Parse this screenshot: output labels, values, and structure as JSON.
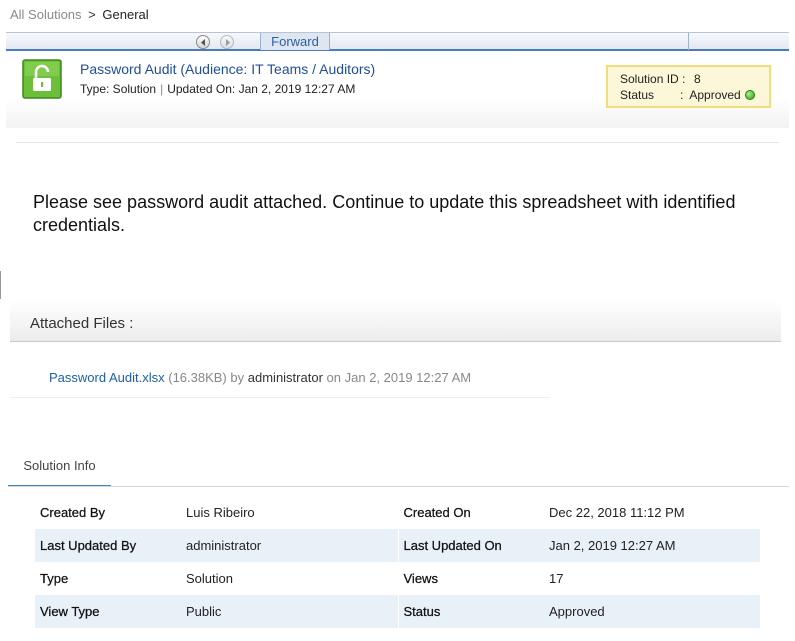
{
  "breadcrumb": {
    "root": "All Solutions",
    "separator": ">",
    "current": "General"
  },
  "toolbar": {
    "forward_label": "Forward"
  },
  "solution": {
    "title": "Password Audit (Audience: IT Teams / Auditors)",
    "type_text": "Type: Solution",
    "updated_text": "Updated On: Jan 2, 2019 12:27 AM"
  },
  "status_box": {
    "id_label": "Solution ID :",
    "id_value": "8",
    "status_label": "Status",
    "status_colon": ":",
    "status_value": "Approved",
    "status_color": "#2ea11a"
  },
  "description": "Please see password audit attached.  Continue to update this spreadsheet with identified credentials.",
  "attachments": {
    "header": "Attached Files :",
    "file_name": "Password Audit.xlsx",
    "file_size": "(16.38KB)",
    "by_label": "by",
    "author": "administrator",
    "on_label": "on",
    "date": "Jan 2, 2019 12:27 AM"
  },
  "info_tab": {
    "label": "Solution Info"
  },
  "info": {
    "rows": [
      {
        "k1": "Created By",
        "v1": "Luis Ribeiro",
        "k2": "Created On",
        "v2": "Dec 22, 2018 11:12 PM"
      },
      {
        "k1": "Last Updated By",
        "v1": "administrator",
        "k2": "Last Updated On",
        "v2": "Jan 2, 2019 12:27 AM"
      },
      {
        "k1": "Type",
        "v1": "Solution",
        "k2": "Views",
        "v2": "17"
      },
      {
        "k1": "View Type",
        "v1": "Public",
        "k2": "Status",
        "v2": "Approved"
      }
    ]
  },
  "colors": {
    "accent": "#3f86c7",
    "link": "#1f4e9c",
    "status_box_bg": "#fcf7d8",
    "row_alt": "#e8f0f8"
  }
}
